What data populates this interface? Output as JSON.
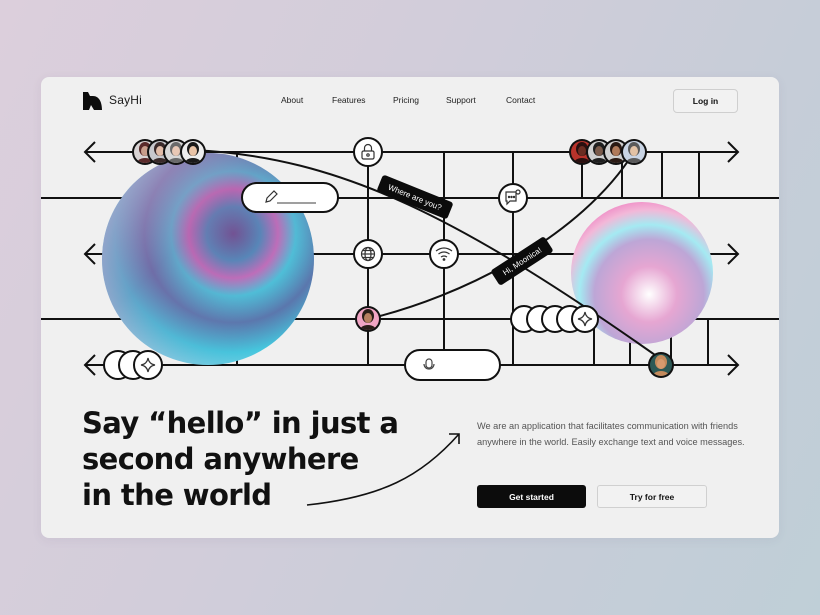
{
  "nav": {
    "brand": "SayHi",
    "links": [
      "About",
      "Features",
      "Pricing",
      "Support",
      "Contact"
    ],
    "login_label": "Log in"
  },
  "scene": {
    "bubbles": [
      "Where are you?",
      "Hi, Moonica!"
    ],
    "node_icons": [
      "lock-icon",
      "pencil-icon",
      "chat-icon",
      "globe-icon",
      "wifi-icon",
      "microphone-icon",
      "star-icon"
    ],
    "avatar_groups": {
      "top_left_count": 4,
      "top_right_count": 4
    }
  },
  "hero": {
    "headline_before": "Say ",
    "headline_highlight": "“hello”",
    "headline_line1_after": " in just a",
    "headline_line2": "second anywhere",
    "headline_line3": "in the world",
    "description": "We are an application that facilitates communication with friends anywhere in the world. Easily exchange text and voice messages.",
    "primary_cta": "Get started",
    "secondary_cta": "Try for free"
  },
  "colors": {
    "ink": "#111111",
    "card_bg": "#f0f0f0",
    "accent_pink": "#e07ac4",
    "accent_cyan": "#4fd0e0"
  }
}
